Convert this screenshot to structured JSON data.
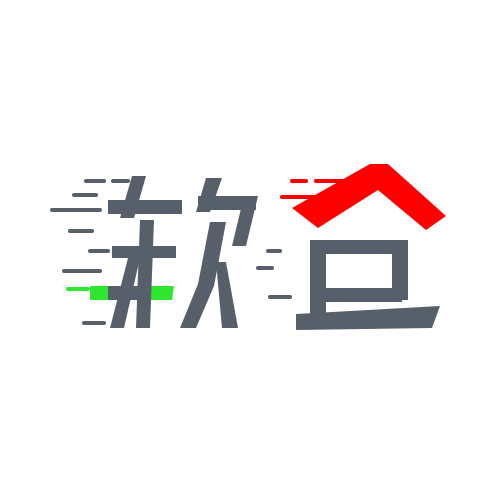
{
  "logo": {
    "text": "软仓",
    "colors": {
      "text": "#575f6b",
      "roof": "#ff0000",
      "green_stroke": "#2ee62e",
      "speed_lines": "#575f6b",
      "background": "#ffffff"
    }
  }
}
